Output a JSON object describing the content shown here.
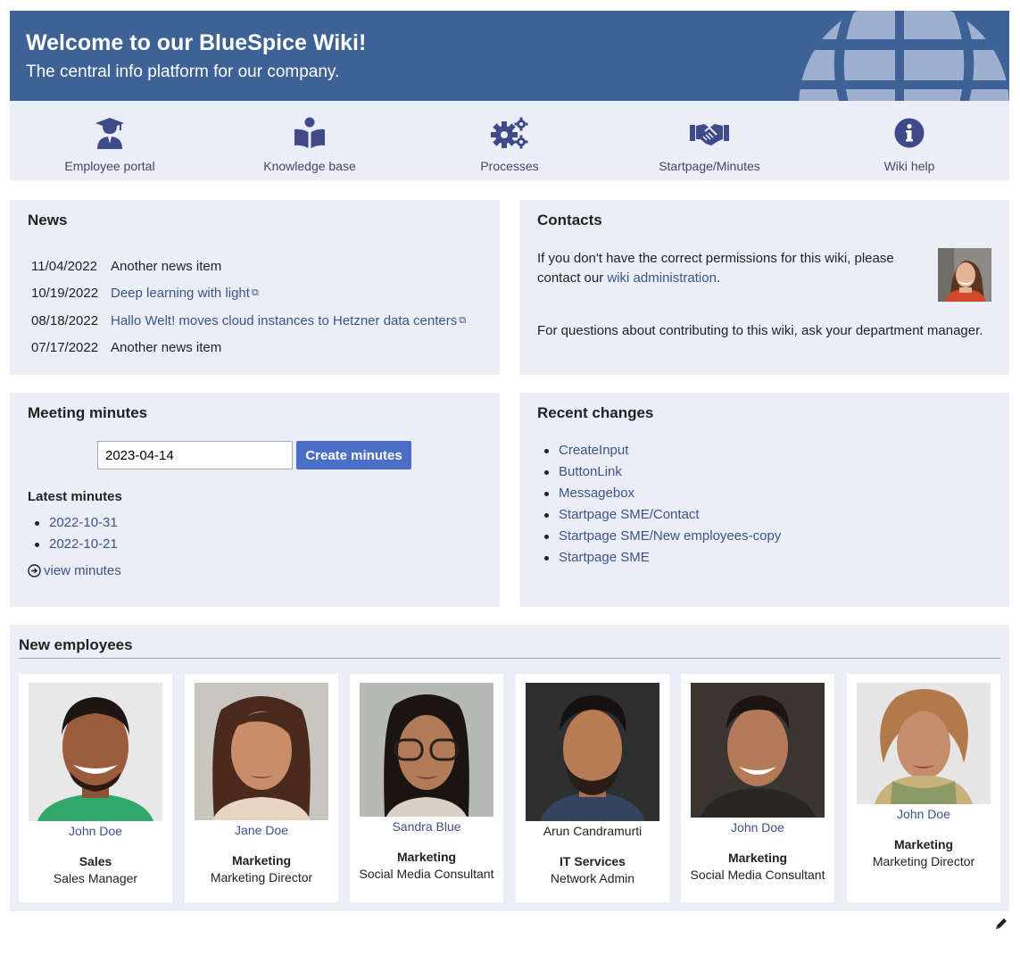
{
  "banner": {
    "title": "Welcome to our BlueSpice Wiki!",
    "subtitle": "The central info platform for our company."
  },
  "nav": [
    {
      "label": "Employee portal",
      "icon": "graduate-icon"
    },
    {
      "label": "Knowledge base",
      "icon": "reader-icon"
    },
    {
      "label": "Processes",
      "icon": "gears-icon"
    },
    {
      "label": "Startpage/Minutes",
      "icon": "handshake-icon"
    },
    {
      "label": "Wiki help",
      "icon": "info-icon"
    }
  ],
  "news": {
    "title": "News",
    "items": [
      {
        "date": "11/04/2022",
        "text": "Another news item"
      },
      {
        "date": "10/19/2022",
        "text": "Deep learning with light"
      },
      {
        "date": "08/18/2022",
        "text": "Hallo Welt! moves cloud instances to Hetzner data centers"
      },
      {
        "date": "07/17/2022",
        "text": "Another news item"
      }
    ]
  },
  "contacts": {
    "title": "Contacts",
    "text_before": "If you don't have the correct permissions for this wiki, please contact our ",
    "link": "wiki administration",
    "text_after": ".",
    "text2": "For questions about contributing to this wiki, ask your department manager."
  },
  "minutes": {
    "title": "Meeting minutes",
    "date_value": "2023-04-14",
    "button": "Create minutes",
    "latest_label": "Latest minutes",
    "latest": [
      "2022-10-31",
      "2022-10-21"
    ],
    "view_link": "view minutes"
  },
  "recent": {
    "title": "Recent changes",
    "items": [
      "CreateInput",
      "ButtonLink",
      "Messagebox",
      "Startpage SME/Contact",
      "Startpage SME/New employees-copy",
      "Startpage SME"
    ]
  },
  "employees": {
    "title": "New employees",
    "people": [
      {
        "name": "John Doe",
        "dept": "Sales",
        "role": "Sales Manager"
      },
      {
        "name": "Jane Doe",
        "dept": "Marketing",
        "role": "Marketing Director"
      },
      {
        "name": "Sandra Blue",
        "dept": "Marketing",
        "role": "Social Media Consultant"
      },
      {
        "name": "Arun Candramurti",
        "dept": "IT Services",
        "role": "Network Admin"
      },
      {
        "name": "John Doe",
        "dept": "Marketing",
        "role": "Social Media Consultant"
      },
      {
        "name": "John Doe",
        "dept": "Marketing",
        "role": "Marketing Director"
      }
    ]
  },
  "colors": {
    "banner": "#3e6196",
    "panel": "#ebeef6",
    "link": "#3e5389",
    "button": "#4b6fc7",
    "icon": "#3e4a8a"
  }
}
